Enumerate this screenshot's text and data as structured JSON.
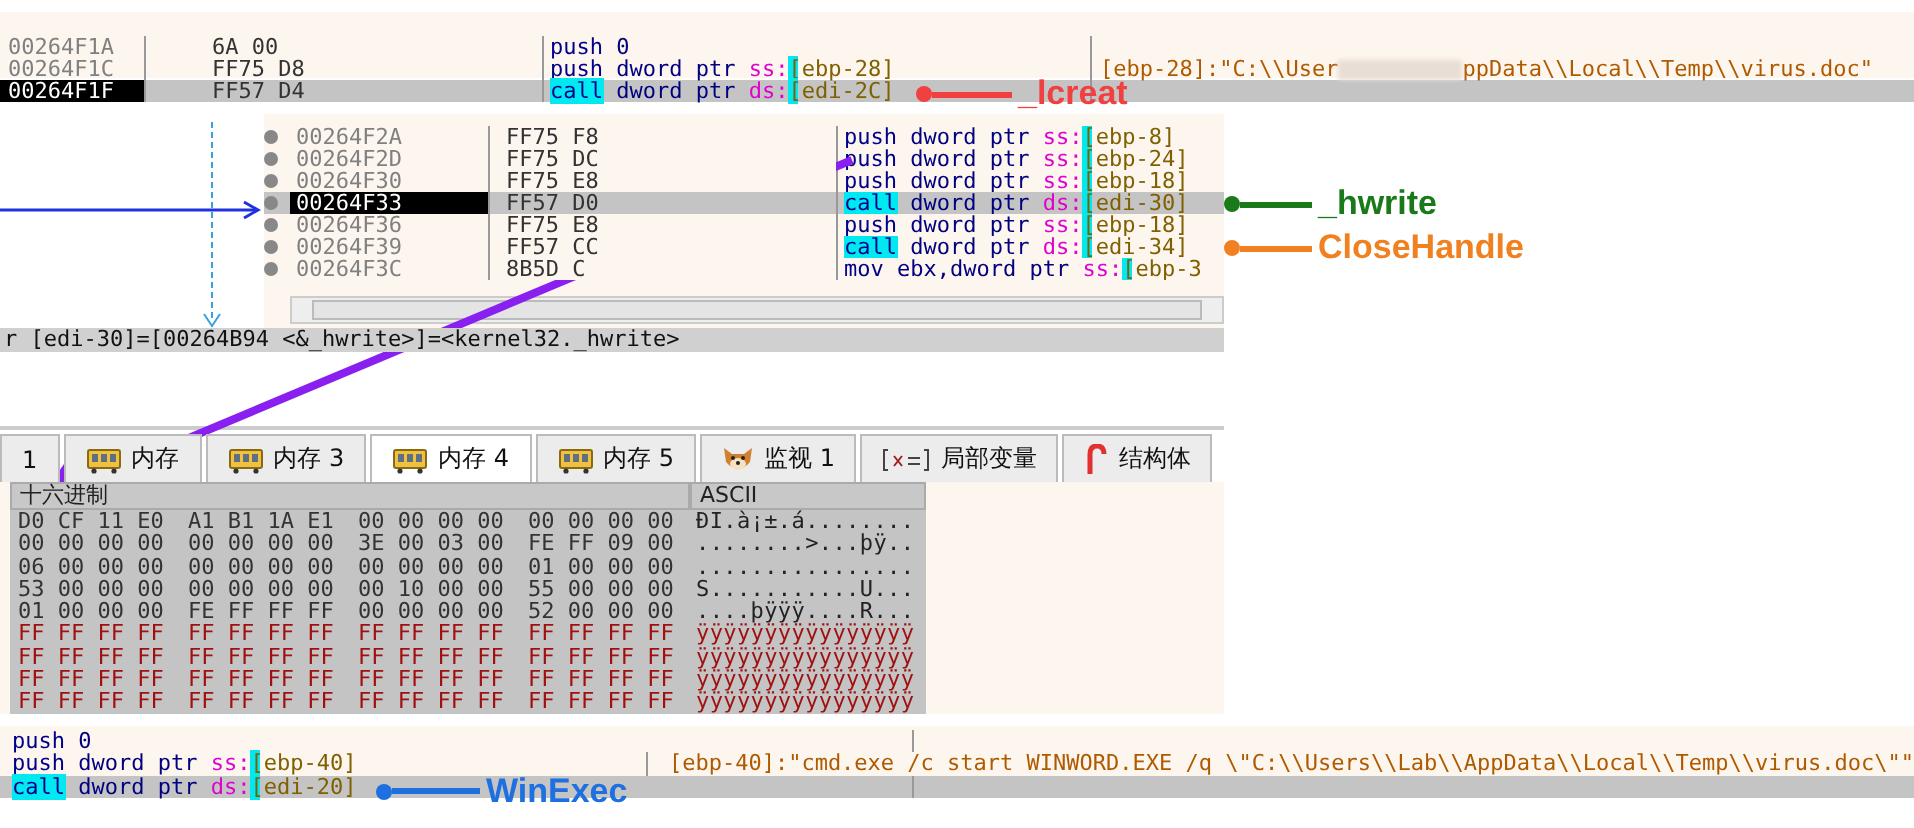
{
  "disasm_top": {
    "rows": [
      {
        "address": "00264F1A",
        "bytes": "6A 00",
        "kind": "push",
        "mnemonic": "push",
        "operand": "0",
        "segment": "",
        "memory": "",
        "comment": [],
        "selected": false
      },
      {
        "address": "00264F1C",
        "bytes": "FF75 D8",
        "kind": "push",
        "mnemonic": "push",
        "operand": "dword ptr ",
        "segment": "ss:",
        "memory": "[ebp-28]",
        "comment": [
          "[ebp-28]:\"C:\\\\User",
          "ppData\\\\Local\\\\Temp\\\\virus.doc\""
        ],
        "selected": false
      },
      {
        "address": "00264F1F",
        "bytes": "FF57 D4",
        "kind": "call",
        "mnemonic": "call",
        "operand": "dword ptr ",
        "segment": "ds:",
        "memory": "[edi-2C]",
        "comment": [],
        "selected": true
      }
    ],
    "annotation": {
      "label": "_lcreat",
      "color": "#f04040"
    }
  },
  "disasm_middle": {
    "rows": [
      {
        "address": "00264F2A",
        "bytes": "FF75 F8",
        "kind": "push",
        "mnemonic": "push",
        "operand": "dword ptr ",
        "segment": "ss:",
        "memory": "[ebp-8]",
        "selected": false
      },
      {
        "address": "00264F2D",
        "bytes": "FF75 DC",
        "kind": "push",
        "mnemonic": "push",
        "operand": "dword ptr ",
        "segment": "ss:",
        "memory": "[ebp-24]",
        "selected": false
      },
      {
        "address": "00264F30",
        "bytes": "FF75 E8",
        "kind": "push",
        "mnemonic": "push",
        "operand": "dword ptr ",
        "segment": "ss:",
        "memory": "[ebp-18]",
        "selected": false
      },
      {
        "address": "00264F33",
        "bytes": "FF57 D0",
        "kind": "call",
        "mnemonic": "call",
        "operand": "dword ptr ",
        "segment": "ds:",
        "memory": "[edi-30]",
        "selected": true
      },
      {
        "address": "00264F36",
        "bytes": "FF75 E8",
        "kind": "push",
        "mnemonic": "push",
        "operand": "dword ptr ",
        "segment": "ss:",
        "memory": "[ebp-18]",
        "selected": false
      },
      {
        "address": "00264F39",
        "bytes": "FF57 CC",
        "kind": "call",
        "mnemonic": "call",
        "operand": "dword ptr ",
        "segment": "ds:",
        "memory": "[edi-34]",
        "selected": false
      },
      {
        "address": "00264F3C",
        "bytes": "8B5D C",
        "kind": "mov",
        "mnemonic": "mov",
        "operand": "ebx,dword ptr ",
        "segment": "ss:",
        "memory": "[ebp-3",
        "selected": false
      }
    ],
    "status": "r [edi-30]=[00264B94 <&_hwrite>]=<kernel32._hwrite>",
    "annotations": [
      {
        "label": "_hwrite",
        "color": "#1a7a1a"
      },
      {
        "label": "CloseHandle",
        "color": "#f08020"
      }
    ]
  },
  "memory": {
    "tabs": [
      {
        "label": "1",
        "kind": "plain",
        "selected": false
      },
      {
        "label": "内存",
        "kind": "memory",
        "selected": false
      },
      {
        "label": "内存 3",
        "kind": "memory",
        "selected": false
      },
      {
        "label": "内存 4",
        "kind": "memory",
        "selected": true
      },
      {
        "label": "内存 5",
        "kind": "memory",
        "selected": false
      },
      {
        "label": "监视 1",
        "kind": "watch",
        "selected": false
      },
      {
        "label": "局部变量",
        "kind": "variable",
        "selected": false
      },
      {
        "label": "结构体",
        "kind": "struct",
        "selected": false
      }
    ],
    "columns": [
      "十六进制",
      "ASCII"
    ],
    "rows": [
      {
        "kind": "data",
        "hex": [
          "D0 CF 11 E0",
          "A1 B1 1A E1",
          "00 00 00 00",
          "00 00 00 00"
        ],
        "ascii": "ÐÏ.à¡±.á........"
      },
      {
        "kind": "data",
        "hex": [
          "00 00 00 00",
          "00 00 00 00",
          "3E 00 03 00",
          "FE FF 09 00"
        ],
        "ascii": "........>...þÿ.."
      },
      {
        "kind": "data",
        "hex": [
          "06 00 00 00",
          "00 00 00 00",
          "00 00 00 00",
          "01 00 00 00"
        ],
        "ascii": "................"
      },
      {
        "kind": "data",
        "hex": [
          "53 00 00 00",
          "00 00 00 00",
          "00 10 00 00",
          "55 00 00 00"
        ],
        "ascii": "S...........U..."
      },
      {
        "kind": "data",
        "hex": [
          "01 00 00 00",
          "FE FF FF FF",
          "00 00 00 00",
          "52 00 00 00"
        ],
        "ascii": "....þÿÿÿ....R..."
      },
      {
        "kind": "fill",
        "hex": [
          "FF FF FF FF",
          "FF FF FF FF",
          "FF FF FF FF",
          "FF FF FF FF"
        ],
        "ascii": "ÿÿÿÿÿÿÿÿÿÿÿÿÿÿÿÿ"
      },
      {
        "kind": "fill",
        "hex": [
          "FF FF FF FF",
          "FF FF FF FF",
          "FF FF FF FF",
          "FF FF FF FF"
        ],
        "ascii": "ÿÿÿÿÿÿÿÿÿÿÿÿÿÿÿÿ"
      },
      {
        "kind": "fill",
        "hex": [
          "FF FF FF FF",
          "FF FF FF FF",
          "FF FF FF FF",
          "FF FF FF FF"
        ],
        "ascii": "ÿÿÿÿÿÿÿÿÿÿÿÿÿÿÿÿ"
      },
      {
        "kind": "fill",
        "hex": [
          "FF FF FF FF",
          "FF FF FF FF",
          "FF FF FF FF",
          "FF FF FF FF"
        ],
        "ascii": "ÿÿÿÿÿÿÿÿÿÿÿÿÿÿÿÿ"
      }
    ]
  },
  "disasm_bottom": {
    "rows": [
      {
        "kind": "push",
        "mnemonic": "push",
        "operand": "0",
        "segment": "",
        "memory": "",
        "comment": "",
        "selected": false
      },
      {
        "kind": "push",
        "mnemonic": "push",
        "operand": "dword ptr ",
        "segment": "ss:",
        "memory": "[ebp-40]",
        "comment": "[ebp-40]:\"cmd.exe /c start WINWORD.EXE /q \\\"C:\\\\Users\\\\Lab\\\\AppData\\\\Local\\\\Temp\\\\virus.doc\\\"\"",
        "selected": false
      },
      {
        "kind": "call",
        "mnemonic": "call",
        "operand": "dword ptr ",
        "segment": "ds:",
        "memory": "[edi-20]",
        "comment": "",
        "selected": true
      }
    ],
    "annotation": {
      "label": "WinExec",
      "color": "#1e6fe0"
    }
  }
}
